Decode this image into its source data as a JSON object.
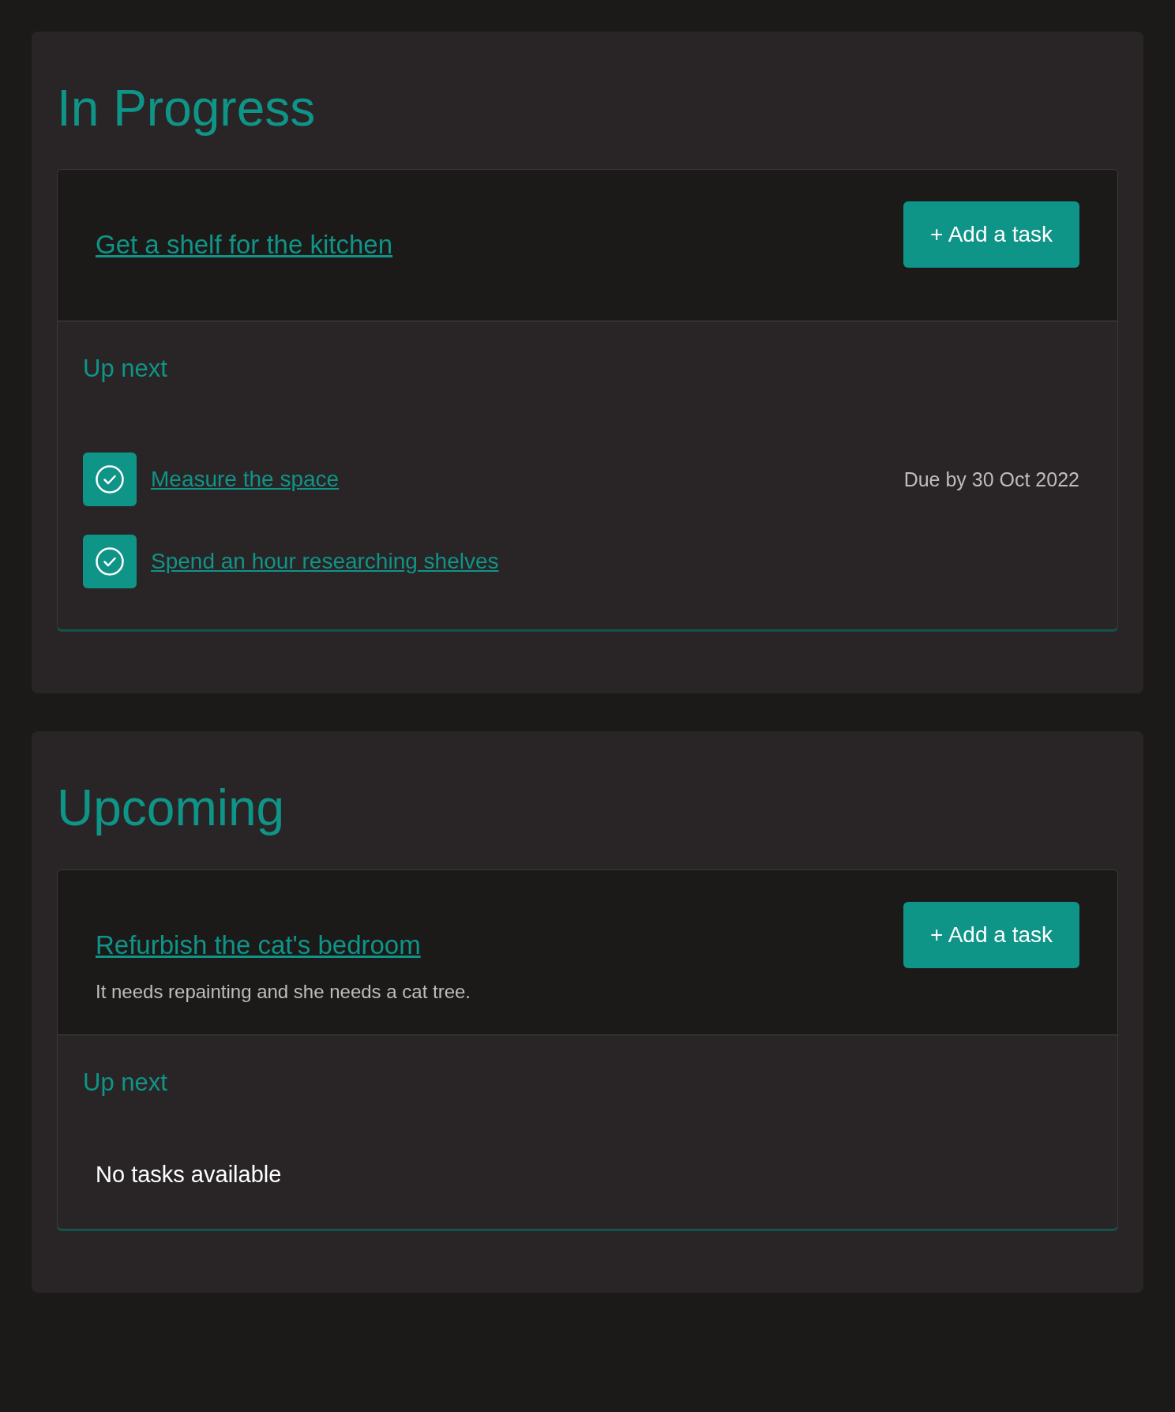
{
  "sections": [
    {
      "title": "In Progress",
      "projects": [
        {
          "title": "Get a shelf for the kitchen",
          "add_button": "+ Add a task",
          "up_next": "Up next",
          "tasks": [
            {
              "title": "Measure the space",
              "due": "Due by 30 Oct 2022"
            },
            {
              "title": "Spend an hour researching shelves"
            }
          ]
        }
      ]
    },
    {
      "title": "Upcoming",
      "projects": [
        {
          "title": "Refurbish the cat's bedroom",
          "description": "It needs repainting and she needs a cat tree.",
          "add_button": "+ Add a task",
          "up_next": "Up next",
          "empty": "No tasks available"
        }
      ]
    }
  ]
}
